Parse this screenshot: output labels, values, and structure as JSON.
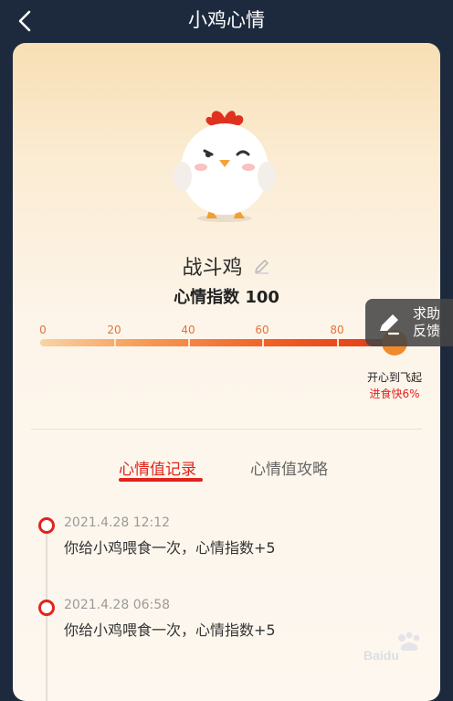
{
  "header": {
    "title": "小鸡心情"
  },
  "pet": {
    "name": "战斗鸡",
    "mood_label": "心情指数 100",
    "mood_value": 100
  },
  "progress": {
    "ticks": [
      "0",
      "20",
      "40",
      "60",
      "80"
    ],
    "fill_percent": 96,
    "goal_title": "开心到飞起",
    "goal_effect": "进食快6%"
  },
  "help": {
    "line1": "求助",
    "line2": "反馈"
  },
  "tabs": [
    {
      "label": "心情值记录",
      "active": true
    },
    {
      "label": "心情值攻略",
      "active": false
    }
  ],
  "records": [
    {
      "time": "2021.4.28 12:12",
      "text": "你给小鸡喂食一次，心情指数+5"
    },
    {
      "time": "2021.4.28 06:58",
      "text": "你给小鸡喂食一次，心情指数+5"
    }
  ],
  "watermark": {
    "brand": "Baidu"
  },
  "colors": {
    "accent": "#e0241c",
    "background": "#1d2a3d",
    "card_top": "#f8dfb4",
    "card_bottom": "#fdf7ef"
  }
}
